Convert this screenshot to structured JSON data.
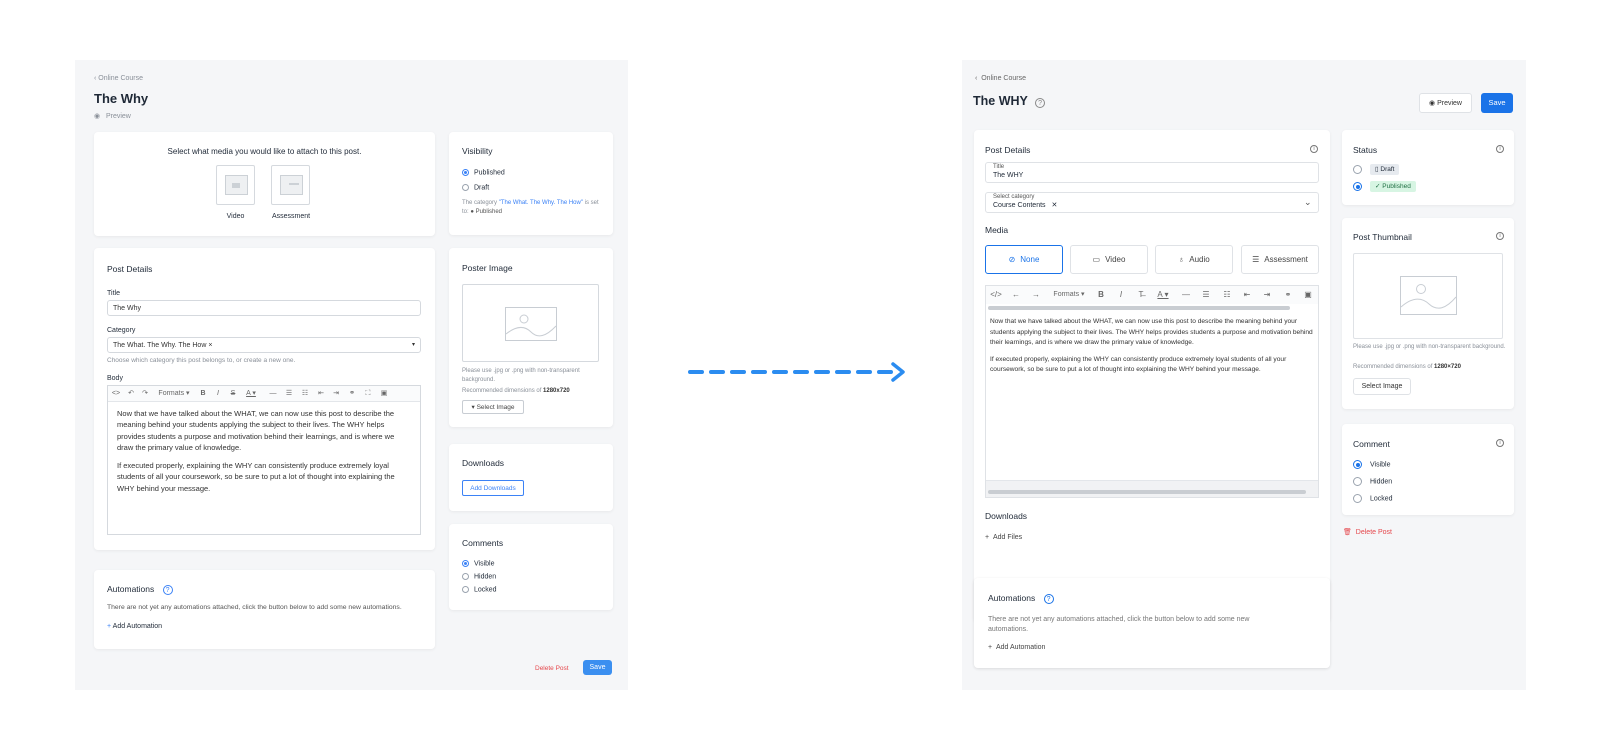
{
  "left": {
    "breadcrumb": "Online Course",
    "title": "The Why",
    "preview": "Preview",
    "media": {
      "prompt": "Select what media you would like to attach to this post.",
      "video": "Video",
      "assessment": "Assessment"
    },
    "post_details": {
      "heading": "Post Details",
      "title_label": "Title",
      "title_value": "The Why",
      "category_label": "Category",
      "category_value": "The What. The Why. The How ×",
      "category_help": "Choose which category this post belongs to, or create a new one.",
      "body_label": "Body",
      "formats": "Formats",
      "body_p1": "Now that we have talked about the WHAT, we can now use this post to describe the meaning behind your students applying the subject to their lives. The WHY helps provides students a purpose and motivation behind their learnings, and is where we draw the primary value of knowledge.",
      "body_p2": "If executed properly, explaining the WHY can consistently produce extremely loyal students of all your coursework, so be sure to put a lot of thought into explaining the WHY behind your message."
    },
    "automations": {
      "heading": "Automations",
      "text": "There are not yet any automations attached, click the button below to add some new automations.",
      "add": "Add Automation"
    },
    "visibility": {
      "heading": "Visibility",
      "published": "Published",
      "draft": "Draft",
      "note_prefix": "The category ",
      "note_link": "\"The What. The Why. The How\"",
      "note_mid": " is set to:",
      "note_status": "Published"
    },
    "poster": {
      "heading": "Poster Image",
      "help": "Please use .jpg or .png with non-transparent background.",
      "dims_label": "Recommended dimensions of ",
      "dims": "1280x720",
      "select": "Select Image"
    },
    "downloads": {
      "heading": "Downloads",
      "add": "Add Downloads"
    },
    "comments": {
      "heading": "Comments",
      "visible": "Visible",
      "hidden": "Hidden",
      "locked": "Locked"
    },
    "delete": "Delete Post",
    "save": "Save"
  },
  "right": {
    "breadcrumb": "Online Course",
    "title": "The WHY",
    "preview": "Preview",
    "save": "Save",
    "post_details": {
      "heading": "Post Details",
      "title_label": "Title",
      "title_value": "The WHY",
      "category_label": "Select category",
      "category_value": "Course Contents",
      "media_heading": "Media",
      "tabs": [
        "None",
        "Video",
        "Audio",
        "Assessment"
      ],
      "formats": "Formats",
      "body_p1": "Now that we have talked about the WHAT, we can now use this post to describe the meaning behind your students applying the subject to their lives. The WHY helps provides students a purpose and motivation behind their learnings, and is where we draw the primary value of knowledge.",
      "body_p2": "If executed properly, explaining the WHY can consistently produce extremely loyal students of all your coursework, so be sure to put a lot of thought into explaining the WHY behind your message.",
      "downloads_heading": "Downloads",
      "add_files": "Add Files"
    },
    "automations": {
      "heading": "Automations",
      "text": "There are not yet any automations attached, click the button below to add some new automations.",
      "add": "Add Automation"
    },
    "status": {
      "heading": "Status",
      "draft": "Draft",
      "published": "Published"
    },
    "thumbnail": {
      "heading": "Post Thumbnail",
      "help": "Please use .jpg or .png with non-transparent background.",
      "dims_label": "Recommended dimensions of ",
      "dims": "1280×720",
      "select": "Select Image"
    },
    "comment": {
      "heading": "Comment",
      "visible": "Visible",
      "hidden": "Hidden",
      "locked": "Locked"
    },
    "delete": "Delete Post"
  },
  "colors": {
    "accent": "#1a73e8",
    "danger": "#e5484d",
    "published_bg": "#d7f5e3",
    "draft_bg": "#e6eaef"
  }
}
